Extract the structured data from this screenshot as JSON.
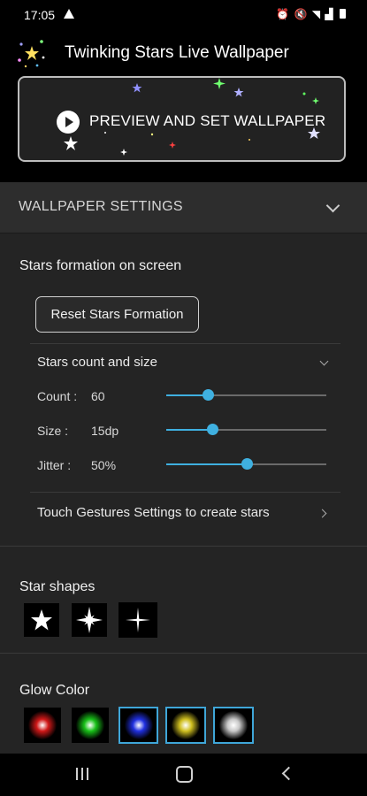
{
  "status_bar": {
    "time": "17:05",
    "icons": [
      "warning-icon",
      "alarm-icon",
      "mute-icon",
      "wifi-icon",
      "signal-icon",
      "battery-icon"
    ]
  },
  "header": {
    "title": "Twinking Stars Live Wallpaper",
    "preview_label": "PREVIEW AND SET WALLPAPER"
  },
  "section": {
    "title": "WALLPAPER SETTINGS"
  },
  "formation": {
    "title": "Stars formation on screen",
    "reset_label": "Reset Stars Formation",
    "subsection_title": "Stars count and size",
    "sliders": [
      {
        "label": "Count :",
        "value": "60",
        "level": 0.26
      },
      {
        "label": "Size :",
        "value": "15dp",
        "level": 0.29
      },
      {
        "label": "Jitter :",
        "value": "50%",
        "level": 0.5
      }
    ],
    "gestures_label": "Touch Gestures Settings to create stars"
  },
  "star_shapes": {
    "title": "Star shapes",
    "items": [
      {
        "name": "five-point-star",
        "selected": false
      },
      {
        "name": "four-point-sparkle",
        "selected": false
      },
      {
        "name": "thin-sparkle",
        "selected": true
      }
    ]
  },
  "glow_color": {
    "title": "Glow Color",
    "items": [
      {
        "color": "#d01818",
        "selected": false
      },
      {
        "color": "#18c018",
        "selected": false
      },
      {
        "color": "#2030e0",
        "selected": true
      },
      {
        "color": "#d0c020",
        "selected": true
      },
      {
        "color": "#c8c8c8",
        "selected": true
      }
    ]
  },
  "colors": {
    "accent": "#3fb0e0",
    "selection_border": "#3fa6d8",
    "background": "#242424"
  }
}
